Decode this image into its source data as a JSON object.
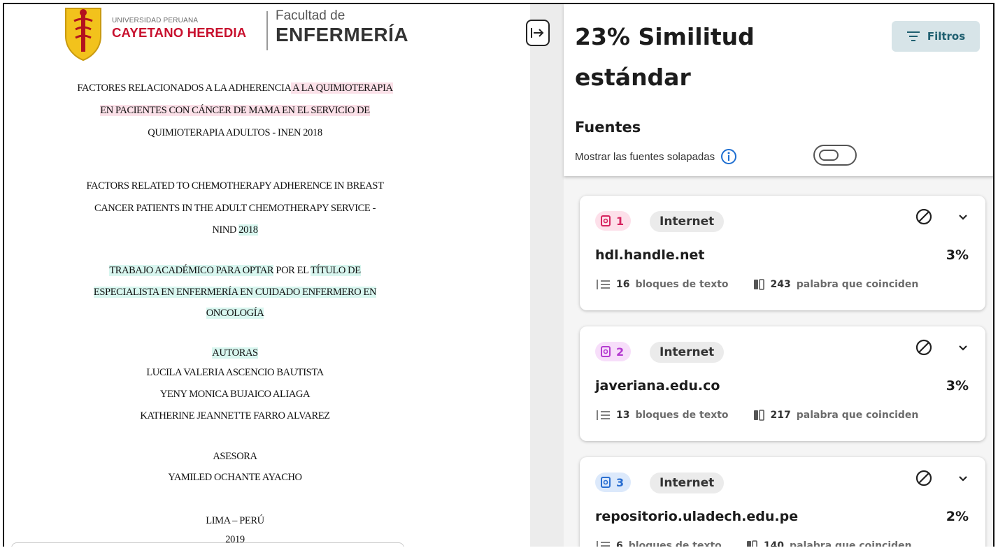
{
  "document": {
    "logo": {
      "university_small": "UNIVERSIDAD PERUANA",
      "university_big": "CAYETANO HEREDIA",
      "faculty_small": "Facultad de",
      "faculty_big": "ENFERMERÍA"
    },
    "title_es": {
      "line1_plain": "FACTORES RELACIONADOS A LA ADHERENCIA",
      "line1_hl": " A LA QUIMIOTERAPIA",
      "line2": "EN PACIENTES CON CÁNCER DE MAMA EN EL SERVICIO DE",
      "line3": "QUIMIOTERAPIA ADULTOS - INEN 2018"
    },
    "title_en": {
      "line1": "FACTORS RELATED TO CHEMOTHERAPY ADHERENCE IN BREAST",
      "line2": "CANCER PATIENTS IN THE ADULT CHEMOTHERAPY SERVICE -",
      "line3_plain": "NIND ",
      "line3_hl": "2018"
    },
    "degree": {
      "line1_hl_a": "TRABAJO ACADÉMICO PARA OPTAR",
      "line1_plain": " POR EL ",
      "line1_hl_b": "TÍTULO DE",
      "line2": "ESPECIALISTA EN ENFERMERÍA EN CUIDADO ENFERMERO EN",
      "line3": "ONCOLOGÍA"
    },
    "authors_heading": "AUTORAS",
    "authors": [
      "LUCILA VALERIA ASCENCIO BAUTISTA",
      "YENY MONICA BUJAICO ALIAGA",
      "KATHERINE JEANNETTE FARRO ALVAREZ"
    ],
    "advisor_heading": "ASESORA",
    "advisor": "YAMILED OCHANTE AYACHO",
    "place": "LIMA – PERÚ",
    "year": "2019"
  },
  "panel": {
    "title_line1": "23% Similitud",
    "title_line2": "estándar",
    "filter_label": "Filtros",
    "sources_heading": "Fuentes",
    "overlap_label": "Mostrar las fuentes solapadas",
    "overlap_toggle_on": false,
    "sources": [
      {
        "num": "1",
        "type": "Internet",
        "domain": "hdl.handle.net",
        "percent": "3%",
        "blocks": "16",
        "blocks_label": "bloques de texto",
        "words": "243",
        "words_label": "palabra que coinciden",
        "chip_bg": "#fde0ea",
        "chip_color": "#d6245f"
      },
      {
        "num": "2",
        "type": "Internet",
        "domain": "javeriana.edu.co",
        "percent": "3%",
        "blocks": "13",
        "blocks_label": "bloques de texto",
        "words": "217",
        "words_label": "palabra que coinciden",
        "chip_bg": "#f7defa",
        "chip_color": "#b43bd0"
      },
      {
        "num": "3",
        "type": "Internet",
        "domain": "repositorio.uladech.edu.pe",
        "percent": "2%",
        "blocks": "6",
        "blocks_label": "bloques de texto",
        "words": "140",
        "words_label": "palabra que coinciden",
        "chip_bg": "#dce9fb",
        "chip_color": "#2a6fd1"
      }
    ]
  },
  "colors": {
    "highlight_pink": "#fbe0e8",
    "highlight_teal": "#d8f6ef",
    "filter_bg": "#d7e4e8",
    "filter_text": "#1f5f70",
    "brand_red": "#c8102e"
  }
}
